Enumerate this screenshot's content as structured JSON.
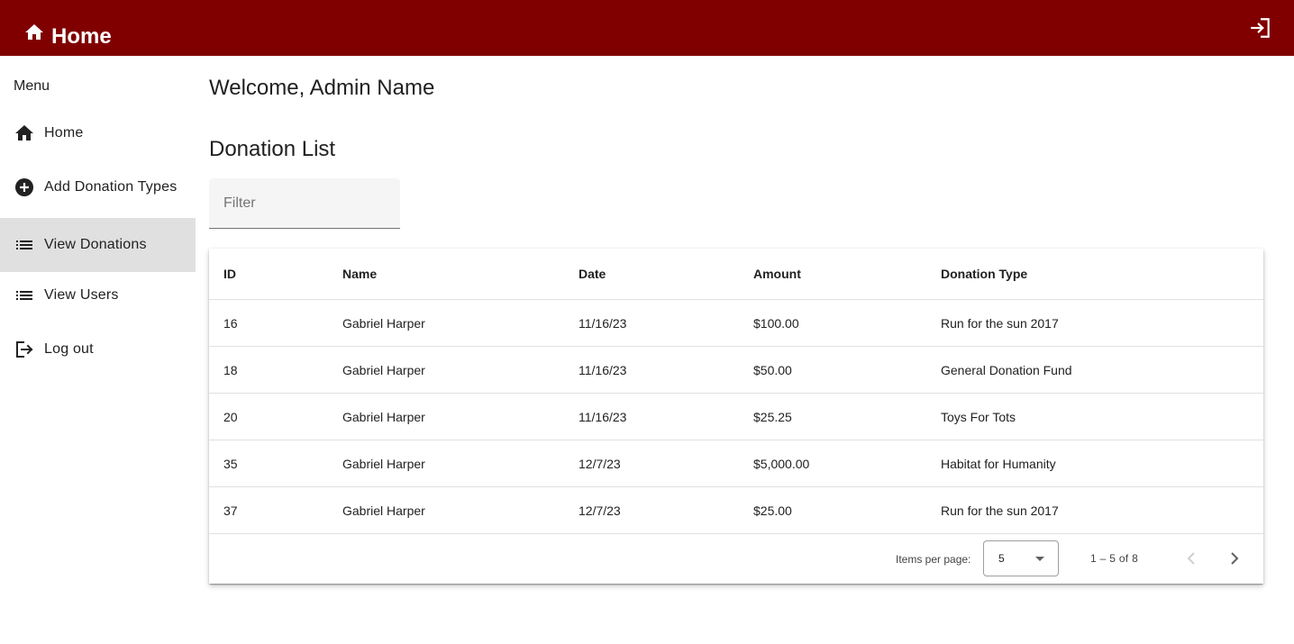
{
  "app": {
    "title": "Home",
    "toolbar_color": "#800000",
    "home_icon": "home-icon",
    "logout_icon": "login-icon"
  },
  "sidebar": {
    "menu_label": "Menu",
    "items": [
      {
        "label": "Home",
        "icon": "home-icon",
        "active": false
      },
      {
        "label": "Add Donation Types",
        "icon": "add-circle-icon",
        "active": false
      },
      {
        "label": "View Donations",
        "icon": "list-icon",
        "active": true
      },
      {
        "label": "View Users",
        "icon": "list-icon",
        "active": false
      },
      {
        "label": "Log out",
        "icon": "logout-icon",
        "active": false
      }
    ]
  },
  "main": {
    "welcome": "Welcome, Admin Name",
    "section_title": "Donation List",
    "filter": {
      "placeholder": "Filter",
      "value": ""
    }
  },
  "table": {
    "columns": [
      "ID",
      "Name",
      "Date",
      "Amount",
      "Donation Type"
    ],
    "rows": [
      [
        "16",
        "Gabriel Harper",
        "11/16/23",
        "$100.00",
        "Run for the sun 2017"
      ],
      [
        "18",
        "Gabriel Harper",
        "11/16/23",
        "$50.00",
        "General Donation Fund"
      ],
      [
        "20",
        "Gabriel Harper",
        "11/16/23",
        "$25.25",
        "Toys For Tots"
      ],
      [
        "35",
        "Gabriel Harper",
        "12/7/23",
        "$5,000.00",
        "Habitat for Humanity"
      ],
      [
        "37",
        "Gabriel Harper",
        "12/7/23",
        "$25.00",
        "Run for the sun 2017"
      ]
    ]
  },
  "paginator": {
    "items_per_page_label": "Items per page:",
    "page_size": "5",
    "range_label": "1 – 5 of 8",
    "prev_icon": "chevron-left-icon",
    "next_icon": "chevron-right-icon"
  }
}
